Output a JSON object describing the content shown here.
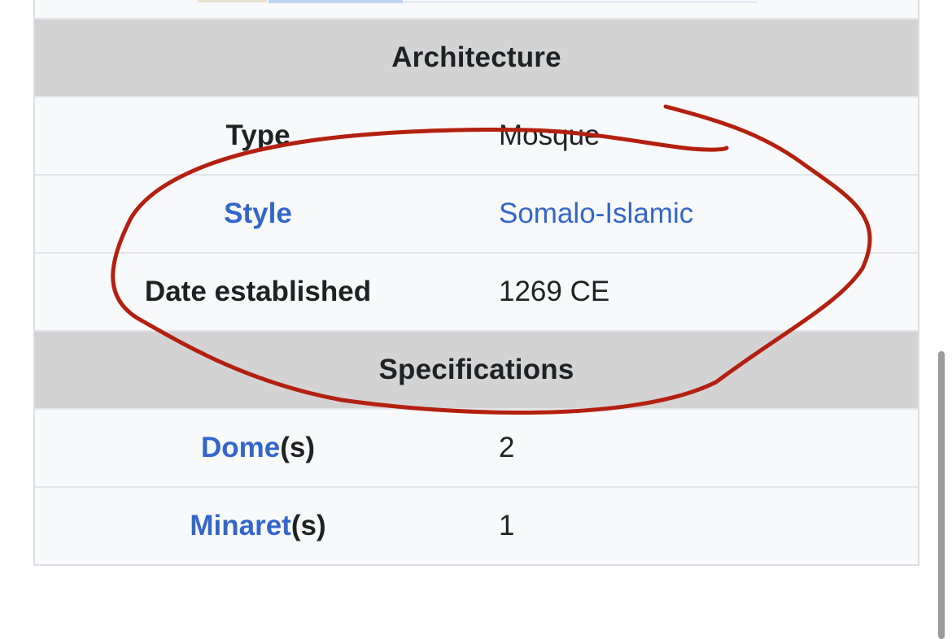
{
  "sections": [
    {
      "title": "Architecture",
      "rows": [
        {
          "label": "Type",
          "label_link": false,
          "label_suffix": "",
          "value": "Mosque",
          "value_link": false
        },
        {
          "label": "Style",
          "label_link": true,
          "label_suffix": "",
          "value": "Somalo-Islamic",
          "value_link": true
        },
        {
          "label": "Date established",
          "label_link": false,
          "label_suffix": "",
          "value": "1269 CE",
          "value_link": false
        }
      ]
    },
    {
      "title": "Specifications",
      "rows": [
        {
          "label": "Dome",
          "label_link": true,
          "label_suffix": "(s)",
          "value": "2",
          "value_link": false
        },
        {
          "label": "Minaret",
          "label_link": true,
          "label_suffix": "(s)",
          "value": "1",
          "value_link": false
        }
      ]
    }
  ],
  "colors": {
    "link": "#3366cc",
    "header_bg": "#d3d3d3",
    "row_bg": "#f8f9fa",
    "annotation_stroke": "#b3200f"
  }
}
